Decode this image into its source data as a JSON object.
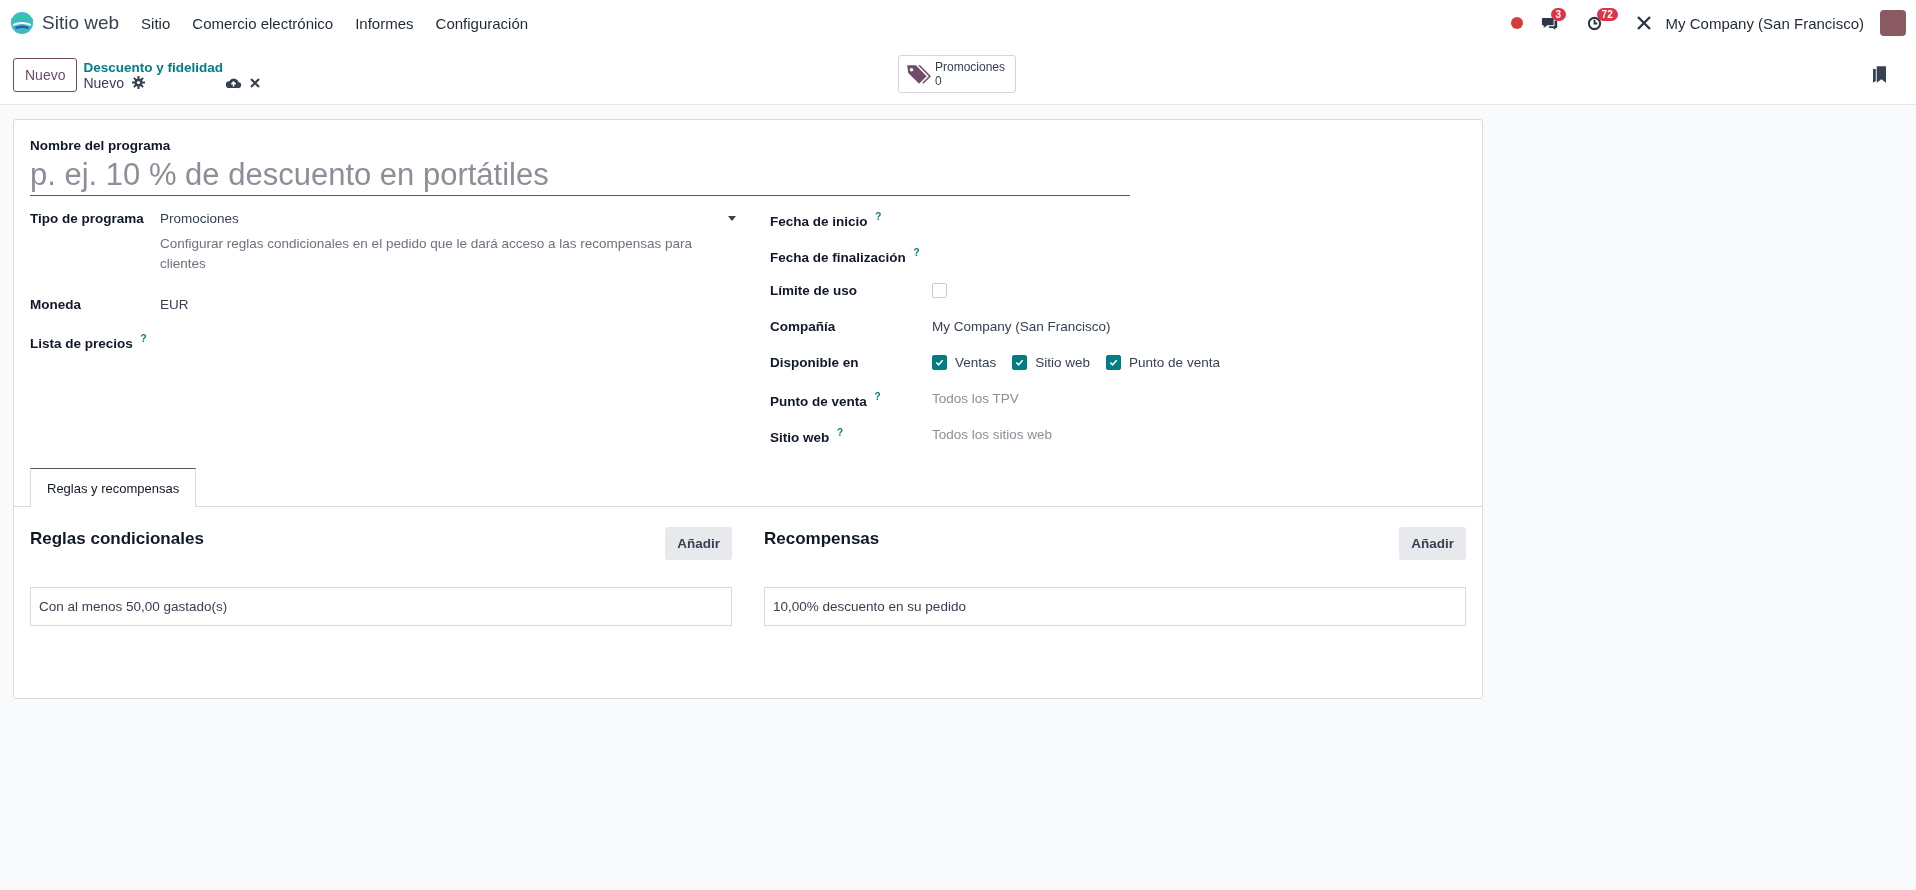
{
  "navbar": {
    "app_name": "Sitio web",
    "menu": [
      "Sitio",
      "Comercio electrónico",
      "Informes",
      "Configuración"
    ],
    "messages_badge": "3",
    "activities_badge": "72",
    "company": "My Company (San Francisco)"
  },
  "control_panel": {
    "new_button": "Nuevo",
    "breadcrumb": "Descuento y fidelidad",
    "record_name": "Nuevo",
    "smart_button": {
      "label": "Promociones",
      "count": "0"
    }
  },
  "form": {
    "name_label": "Nombre del programa",
    "name_placeholder": "p. ej. 10 % de descuento en portátiles",
    "left_fields": [
      {
        "kind": "select",
        "label": "Tipo de programa",
        "value": "Promociones",
        "help": "Configurar reglas condicionales en el pedido que le dará acceso a las recompensas para clientes"
      },
      {
        "kind": "text",
        "label": "Moneda",
        "value": "EUR"
      },
      {
        "kind": "empty",
        "label": "Lista de precios",
        "tooltip": "?"
      }
    ],
    "right_fields": [
      {
        "kind": "empty",
        "label": "Fecha de inicio",
        "tooltip": "?"
      },
      {
        "kind": "empty",
        "label": "Fecha de finalización",
        "tooltip": "?"
      },
      {
        "kind": "checkbox",
        "label": "Límite de uso",
        "checked": false
      },
      {
        "kind": "text",
        "label": "Compañía",
        "value": "My Company (San Francisco)"
      },
      {
        "kind": "checkboxes",
        "label": "Disponible en",
        "options": [
          {
            "label": "Ventas",
            "checked": true
          },
          {
            "label": "Sitio web",
            "checked": true
          },
          {
            "label": "Punto de venta",
            "checked": true
          }
        ]
      },
      {
        "kind": "placeholder",
        "label": "Punto de venta",
        "placeholder": "Todos los TPV",
        "tooltip": "?"
      },
      {
        "kind": "placeholder",
        "label": "Sitio web",
        "placeholder": "Todos los sitios web",
        "tooltip": "?"
      }
    ],
    "tabs": [
      {
        "label": "Reglas y recompensas",
        "selected": true
      }
    ],
    "sections": [
      {
        "title": "Reglas condicionales",
        "button": "Añadir",
        "rows": [
          "Con al menos 50,00 gastado(s)"
        ]
      },
      {
        "title": "Recompensas",
        "button": "Añadir",
        "rows": [
          "10,00% descuento en su pedido"
        ]
      }
    ]
  }
}
